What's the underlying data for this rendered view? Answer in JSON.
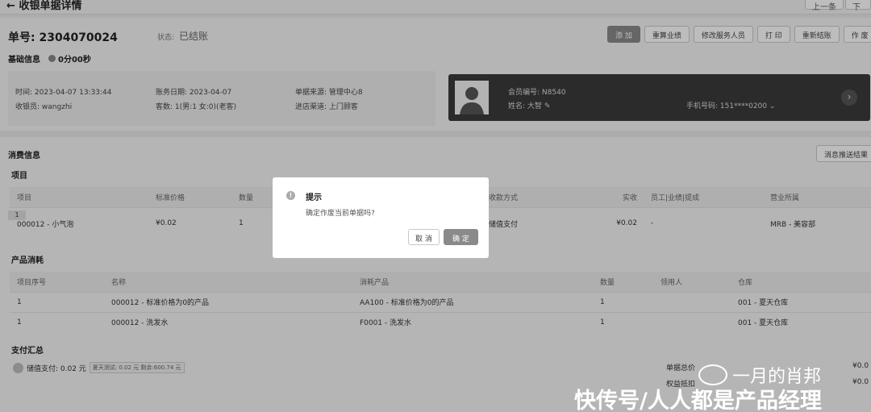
{
  "header": {
    "title": "收银单据详情",
    "prev_label": "上一条",
    "next_label": "下一"
  },
  "order": {
    "no_label": "单号:",
    "no": "2304070024",
    "status_label": "状态:",
    "status": "已结账"
  },
  "actions": [
    "添 加",
    "重算业绩",
    "修改服务人员",
    "打 印",
    "重新结账",
    "作 废"
  ],
  "basic": {
    "title": "基础信息",
    "timer": "0分00秒",
    "fields": [
      {
        "label": "时间:",
        "value": "2023-04-07 13:33:44"
      },
      {
        "label": "账务日期:",
        "value": "2023-04-07"
      },
      {
        "label": "单据来源:",
        "value": "管理中心8"
      },
      {
        "label": "收银员:",
        "value": "wangzhi"
      },
      {
        "label": "客数:",
        "value": "1(男:1 女:0)(老客)"
      },
      {
        "label": "进店渠道:",
        "value": "上门顾客"
      }
    ]
  },
  "member": {
    "no_label": "会员编号:",
    "no": "N8540",
    "name_label": "姓名:",
    "name": "大智",
    "phone_label": "手机号码:",
    "phone": "151****0200"
  },
  "consume": {
    "title": "消费信息",
    "push_label": "消息推送结果",
    "sub_title": "项目",
    "columns": [
      "项目",
      "标准价格",
      "数量",
      "收款方式",
      "实收",
      "员工|业绩|提成",
      "营业所属"
    ],
    "row_index": "1",
    "row": [
      "000012 - 小气泡",
      "¥0.02",
      "1",
      "储值支付",
      "¥0.02",
      "-",
      "MRB - 美容部"
    ]
  },
  "products": {
    "title": "产品消耗",
    "columns": [
      "项目序号",
      "名称",
      "消耗产品",
      "数量",
      "领用人",
      "仓库"
    ],
    "rows": [
      [
        "1",
        "000012 - 标准价格为0的产品",
        "AA100 - 标准价格为0的产品",
        "1",
        "",
        "001 - 夏天仓库"
      ],
      [
        "1",
        "000012 - 洗发水",
        "F0001 - 洗发水",
        "1",
        "",
        "001 - 夏天仓库"
      ]
    ]
  },
  "payment": {
    "title": "支付汇总",
    "line": "储值支付: 0.02 元",
    "tag": "夏天测试: 0.02 元 剩余:600.74 元",
    "total_label": "单据总价",
    "total_value": "¥0.0",
    "deduct_label": "权益抵扣",
    "deduct_value": "¥0.0"
  },
  "dialog": {
    "title": "提示",
    "message": "确定作废当前单据吗?",
    "cancel": "取 消",
    "ok": "确 定",
    "icon": "!"
  },
  "watermark": {
    "name": "一月的肖邦",
    "site": "快传号/人人都是产品经理"
  }
}
